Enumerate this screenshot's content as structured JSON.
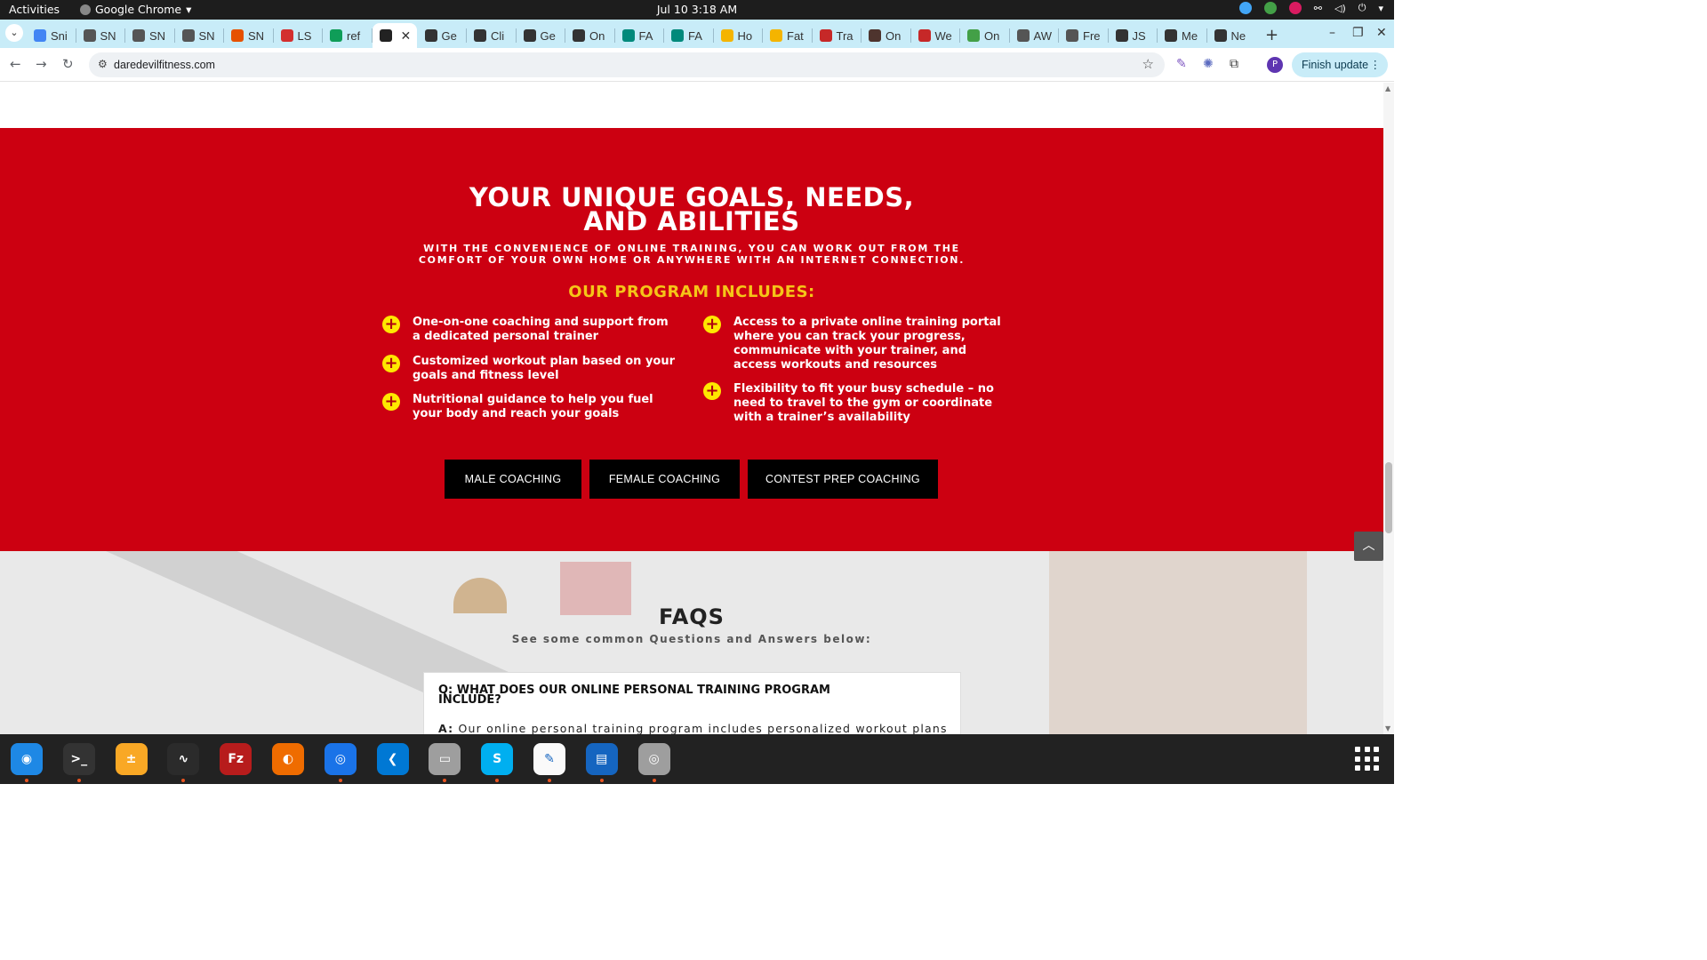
{
  "system": {
    "activities": "Activities",
    "app_name": "Google Chrome",
    "clock": "Jul 10  3:18 AM"
  },
  "browser": {
    "tabs": [
      "Sni",
      "SN",
      "SN",
      "SN",
      "SN",
      "LS",
      "ref",
      "",
      "Ge",
      "Cli",
      "Ge",
      "On",
      "FA",
      "FA",
      "Ho",
      "Fat",
      "Tra",
      "On",
      "We",
      "On",
      "AW",
      "Fre",
      "JS",
      "Me",
      "Ne"
    ],
    "active_tab_index": 7,
    "url": "daredevilfitness.com",
    "finish_update": "Finish update",
    "profile_initial": "P"
  },
  "page": {
    "headline_line1": "YOUR UNIQUE GOALS, NEEDS,",
    "headline_line2": "AND ABILITIES",
    "subhead": "WITH THE CONVENIENCE OF ONLINE TRAINING, YOU CAN WORK OUT FROM THE COMFORT OF YOUR OWN HOME OR ANYWHERE WITH AN INTERNET CONNECTION.",
    "program_title": "OUR PROGRAM INCLUDES:",
    "features_left": [
      "One-on-one coaching and support from a dedicated personal trainer",
      "Customized workout plan based on your goals and fitness level",
      "Nutritional guidance to help you fuel your body and reach your goals"
    ],
    "features_right": [
      "Access to a private online training portal where you can track your progress, communicate with your trainer, and access workouts and resources",
      "Flexibility to fit your busy schedule – no need to travel to the gym or coordinate with a trainer’s availability"
    ],
    "buttons": [
      "MALE COACHING",
      "FEMALE COACHING",
      "CONTEST PREP COACHING"
    ],
    "faq_title": "FAQS",
    "faq_subtitle": "See some common Questions and Answers below:",
    "faq_question": "Q: WHAT DOES OUR ONLINE PERSONAL TRAINING PROGRAM INCLUDE?",
    "faq_answer_prefix": "A:",
    "faq_answer": "Our online personal training program includes personalized workout plans"
  },
  "colors": {
    "brand_red": "#cc0011",
    "accent_yellow": "#f5c518",
    "button_black": "#000000"
  },
  "dock": [
    "Thunderbird",
    "Terminal",
    "Calculator",
    "System Monitor",
    "FileZilla",
    "Firefox",
    "Chrome",
    "VS Code",
    "Files",
    "Skype",
    "Text Editor",
    "Writer",
    "Disks"
  ]
}
